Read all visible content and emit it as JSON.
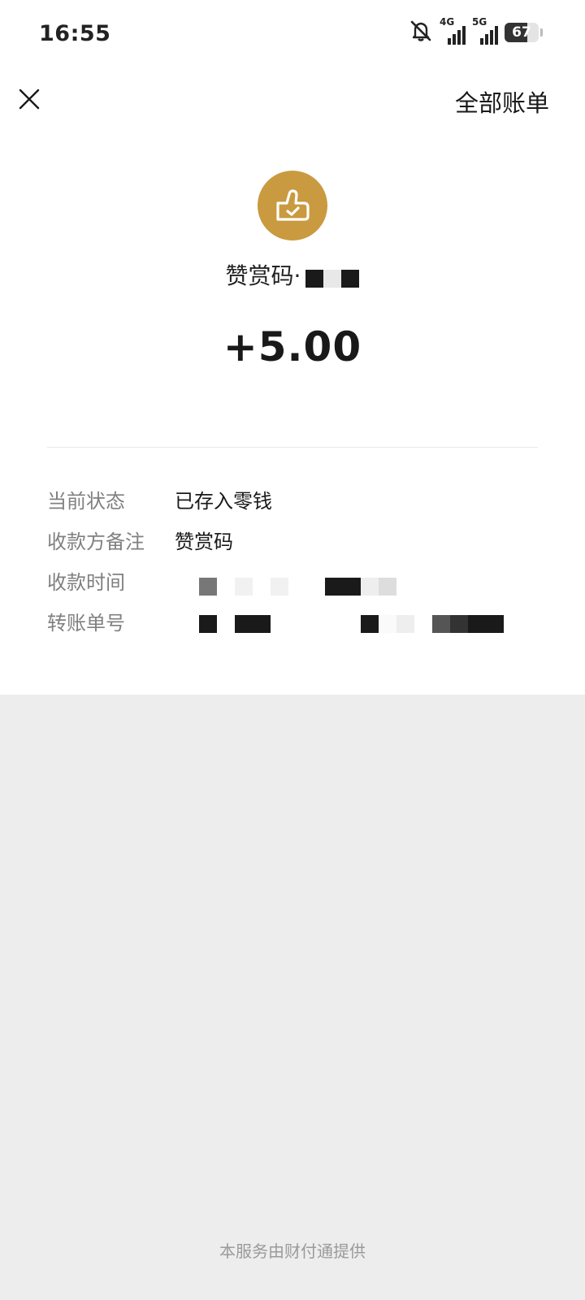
{
  "status_bar": {
    "time": "16:55",
    "net1": "4G",
    "net2": "5G",
    "battery": "67",
    "battery_level": 0.67
  },
  "header": {
    "close_icon": "close-icon",
    "right_link": "全部账单"
  },
  "summary": {
    "icon": "thumbs-up-check-icon",
    "accent_color": "#c99a3f",
    "payer_prefix": "赞赏码·",
    "amount": "+5.00"
  },
  "details": [
    {
      "label": "当前状态",
      "value": "已存入零钱"
    },
    {
      "label": "收款方备注",
      "value": "赞赏码"
    },
    {
      "label": "收款时间",
      "value": ""
    },
    {
      "label": "转账单号",
      "value": ""
    }
  ],
  "footer": {
    "text": "本服务由财付通提供"
  }
}
